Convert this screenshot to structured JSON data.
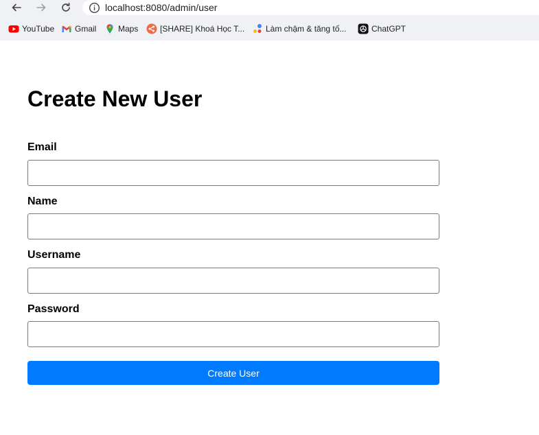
{
  "browser": {
    "url": "localhost:8080/admin/user",
    "bookmarks": [
      {
        "label": "YouTube",
        "icon": "youtube-icon"
      },
      {
        "label": "Gmail",
        "icon": "gmail-icon"
      },
      {
        "label": "Maps",
        "icon": "maps-icon"
      },
      {
        "label": "[SHARE] Khoá Học T...",
        "icon": "share-icon"
      },
      {
        "label": "Làm chậm & tăng tố...",
        "icon": "dots-icon"
      },
      {
        "label": "ChatGPT",
        "icon": "chatgpt-icon"
      }
    ]
  },
  "form": {
    "title": "Create New User",
    "fields": [
      {
        "label": "Email",
        "value": ""
      },
      {
        "label": "Name",
        "value": ""
      },
      {
        "label": "Username",
        "value": ""
      },
      {
        "label": "Password",
        "value": ""
      }
    ],
    "submit_label": "Create User"
  },
  "colors": {
    "accent": "#007bff",
    "chrome_bg": "#eff1f5"
  }
}
